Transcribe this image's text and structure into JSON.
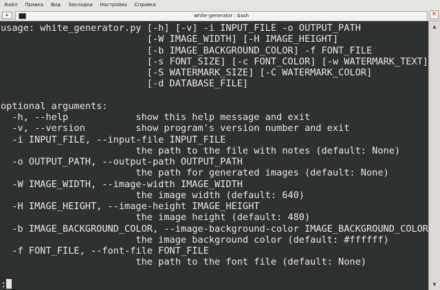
{
  "menu": [
    "Файл",
    "Правка",
    "Вид",
    "Закладки",
    "Настройка",
    "Справка"
  ],
  "tab": {
    "title": "white-generator : bash",
    "close": "×"
  },
  "window": {
    "close": "✕"
  },
  "scrollbar": {
    "up": "▲",
    "down": "▼"
  },
  "terminal": {
    "lines": [
      "usage: white_generator.py [-h] [-v] -i INPUT_FILE -o OUTPUT_PATH",
      "                          [-W IMAGE_WIDTH] [-H IMAGE_HEIGHT]",
      "                          [-b IMAGE_BACKGROUND_COLOR] -f FONT_FILE",
      "                          [-s FONT_SIZE] [-c FONT_COLOR] [-w WATERMARK_TEXT]",
      "                          [-S WATERMARK_SIZE] [-C WATERMARK_COLOR]",
      "                          [-d DATABASE_FILE]",
      "",
      "optional arguments:",
      "  -h, --help            show this help message and exit",
      "  -v, --version         show program's version number and exit",
      "  -i INPUT_FILE, --input-file INPUT_FILE",
      "                        the path to the file with notes (default: None)",
      "  -o OUTPUT_PATH, --output-path OUTPUT_PATH",
      "                        the path for generated images (default: None)",
      "  -W IMAGE_WIDTH, --image-width IMAGE_WIDTH",
      "                        the image width (default: 640)",
      "  -H IMAGE_HEIGHT, --image-height IMAGE_HEIGHT",
      "                        the image height (default: 480)",
      "  -b IMAGE_BACKGROUND_COLOR, --image-background-color IMAGE_BACKGROUND_COLOR",
      "                        the image background color (default: #ffffff)",
      "  -f FONT_FILE, --font-file FONT_FILE",
      "                        the path to the font file (default: None)",
      ""
    ],
    "prompt": ":"
  }
}
